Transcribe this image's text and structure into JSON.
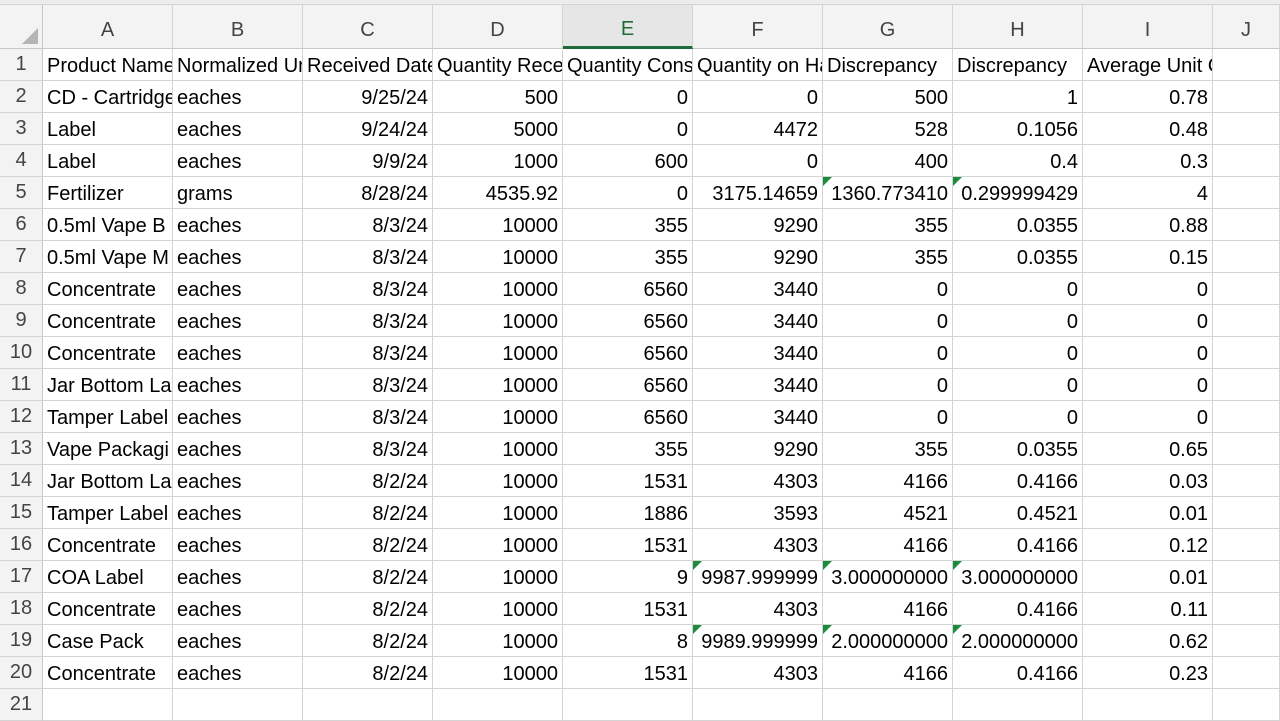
{
  "columns": [
    "A",
    "B",
    "C",
    "D",
    "E",
    "F",
    "G",
    "H",
    "I",
    "J"
  ],
  "active_column": "E",
  "rows": [
    {
      "num": "1",
      "cells": [
        "Product Name",
        "Normalized Unit",
        "Received Date",
        "Quantity Received",
        "Quantity Consumed",
        "Quantity on Hand",
        "Discrepancy",
        "Discrepancy",
        "Average Unit Cost",
        ""
      ]
    },
    {
      "num": "2",
      "cells": [
        "CD - Cartridge",
        "eaches",
        "9/25/24",
        "500",
        "0",
        "0",
        "500",
        "1",
        "0.78",
        ""
      ]
    },
    {
      "num": "3",
      "cells": [
        "Label",
        "eaches",
        "9/24/24",
        "5000",
        "0",
        "4472",
        "528",
        "0.1056",
        "0.48",
        ""
      ]
    },
    {
      "num": "4",
      "cells": [
        "Label",
        "eaches",
        "9/9/24",
        "1000",
        "600",
        "0",
        "400",
        "0.4",
        "0.3",
        ""
      ]
    },
    {
      "num": "5",
      "cells": [
        "Fertilizer",
        "grams",
        "8/28/24",
        "4535.92",
        "0",
        "3175.14659",
        "1360.773410",
        "0.299999429",
        "4",
        ""
      ]
    },
    {
      "num": "6",
      "cells": [
        "0.5ml Vape B",
        "eaches",
        "8/3/24",
        "10000",
        "355",
        "9290",
        "355",
        "0.0355",
        "0.88",
        ""
      ]
    },
    {
      "num": "7",
      "cells": [
        "0.5ml Vape M",
        "eaches",
        "8/3/24",
        "10000",
        "355",
        "9290",
        "355",
        "0.0355",
        "0.15",
        ""
      ]
    },
    {
      "num": "8",
      "cells": [
        "Concentrate",
        "eaches",
        "8/3/24",
        "10000",
        "6560",
        "3440",
        "0",
        "0",
        "0",
        ""
      ]
    },
    {
      "num": "9",
      "cells": [
        "Concentrate",
        "eaches",
        "8/3/24",
        "10000",
        "6560",
        "3440",
        "0",
        "0",
        "0",
        ""
      ]
    },
    {
      "num": "10",
      "cells": [
        "Concentrate",
        "eaches",
        "8/3/24",
        "10000",
        "6560",
        "3440",
        "0",
        "0",
        "0",
        ""
      ]
    },
    {
      "num": "11",
      "cells": [
        "Jar Bottom La",
        "eaches",
        "8/3/24",
        "10000",
        "6560",
        "3440",
        "0",
        "0",
        "0",
        ""
      ]
    },
    {
      "num": "12",
      "cells": [
        "Tamper Label",
        "eaches",
        "8/3/24",
        "10000",
        "6560",
        "3440",
        "0",
        "0",
        "0",
        ""
      ]
    },
    {
      "num": "13",
      "cells": [
        "Vape Packagi",
        "eaches",
        "8/3/24",
        "10000",
        "355",
        "9290",
        "355",
        "0.0355",
        "0.65",
        ""
      ]
    },
    {
      "num": "14",
      "cells": [
        "Jar Bottom La",
        "eaches",
        "8/2/24",
        "10000",
        "1531",
        "4303",
        "4166",
        "0.4166",
        "0.03",
        ""
      ]
    },
    {
      "num": "15",
      "cells": [
        "Tamper Label",
        "eaches",
        "8/2/24",
        "10000",
        "1886",
        "3593",
        "4521",
        "0.4521",
        "0.01",
        ""
      ]
    },
    {
      "num": "16",
      "cells": [
        "Concentrate",
        "eaches",
        "8/2/24",
        "10000",
        "1531",
        "4303",
        "4166",
        "0.4166",
        "0.12",
        ""
      ]
    },
    {
      "num": "17",
      "cells": [
        "COA Label",
        "eaches",
        "8/2/24",
        "10000",
        "9",
        "9987.999999",
        "3.000000000",
        "3.000000000",
        "0.01",
        ""
      ]
    },
    {
      "num": "18",
      "cells": [
        "Concentrate",
        "eaches",
        "8/2/24",
        "10000",
        "1531",
        "4303",
        "4166",
        "0.4166",
        "0.11",
        ""
      ]
    },
    {
      "num": "19",
      "cells": [
        "Case Pack",
        "eaches",
        "8/2/24",
        "10000",
        "8",
        "9989.999999",
        "2.000000000",
        "2.000000000",
        "0.62",
        ""
      ]
    },
    {
      "num": "20",
      "cells": [
        "Concentrate",
        "eaches",
        "8/2/24",
        "10000",
        "1531",
        "4303",
        "4166",
        "0.4166",
        "0.23",
        ""
      ]
    },
    {
      "num": "21",
      "cells": [
        "",
        "",
        "",
        "",
        "",
        "",
        "",
        "",
        "",
        ""
      ]
    }
  ],
  "text_columns": [
    0,
    1
  ],
  "spill_cells": [
    "1-8"
  ],
  "error_flags": [
    "5-6",
    "5-7",
    "17-5",
    "17-6",
    "17-7",
    "19-5",
    "19-6",
    "19-7"
  ]
}
